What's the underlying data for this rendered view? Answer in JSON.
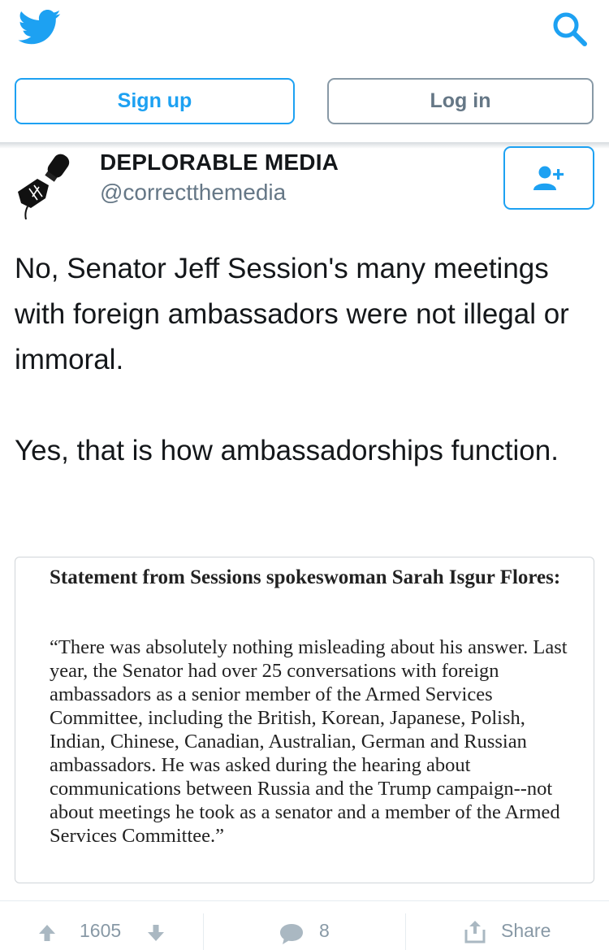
{
  "header": {
    "logo_icon": "twitter-bird-icon",
    "search_icon": "search-icon",
    "signup_label": "Sign up",
    "login_label": "Log in"
  },
  "colors": {
    "brand": "#1da1f2",
    "muted": "#657786",
    "border": "#8899a6",
    "text": "#14171a"
  },
  "tweet": {
    "avatar_icon": "microphone-fist-avatar",
    "display_name": "DEPLORABLE MEDIA",
    "handle": "@correctthemedia",
    "follow_icon": "add-user-icon",
    "paragraphs": [
      "No, Senator Jeff Session's many meetings with foreign ambassadors were not illegal or immoral.",
      "Yes, that is how ambassadorships function."
    ],
    "media": {
      "heading": "Statement from Sessions spokeswoman Sarah Isgur Flores:",
      "body": "“There was absolutely nothing misleading about his answer. Last year, the Senator had over 25 conversations with foreign ambassadors as a senior member of the Armed Services Committee, including the British, Korean, Japanese, Polish, Indian, Chinese, Canadian, Australian, German and Russian ambassadors. He was asked during the hearing about communications between Russia and the Trump campaign--not about meetings he took as a senator and a member of the Armed Services Committee.”"
    }
  },
  "actions": {
    "vote_count": "1605",
    "reply_count": "8",
    "share_label": "Share",
    "upvote_icon": "arrow-up-icon",
    "downvote_icon": "arrow-down-icon",
    "reply_icon": "speech-bubble-icon",
    "share_icon": "share-icon"
  }
}
